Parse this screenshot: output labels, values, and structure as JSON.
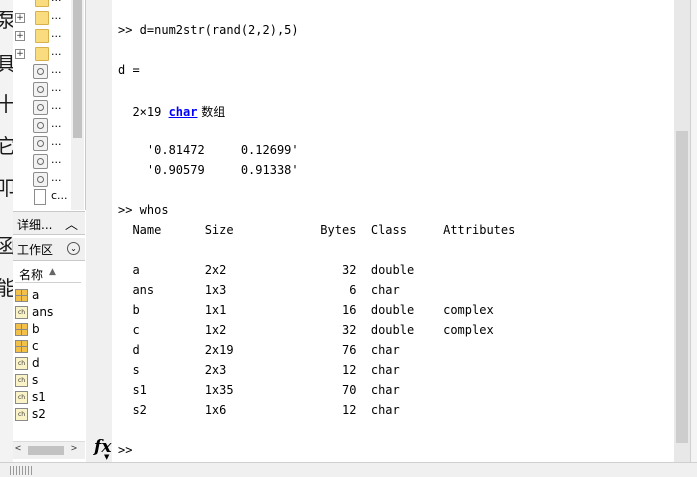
{
  "file_browser": {
    "items": [
      {
        "type": "folder",
        "expander": "",
        "label": "..."
      },
      {
        "type": "folder",
        "expander": "+",
        "label": "..."
      },
      {
        "type": "folder",
        "expander": "+",
        "label": "..."
      },
      {
        "type": "folder",
        "expander": "+",
        "label": "..."
      },
      {
        "type": "file",
        "label": "..."
      },
      {
        "type": "file",
        "label": "..."
      },
      {
        "type": "file",
        "label": "..."
      },
      {
        "type": "file",
        "label": "..."
      },
      {
        "type": "file",
        "label": "..."
      },
      {
        "type": "file",
        "label": "..."
      },
      {
        "type": "file",
        "label": "..."
      },
      {
        "type": "doc",
        "label": "c..."
      }
    ]
  },
  "details_bar": {
    "label": "详细...",
    "chevron": "︿"
  },
  "workspace": {
    "title": "工作区",
    "menu_icon": "⌄",
    "column_name": "名称",
    "sort_indicator": "▲",
    "variables": [
      {
        "name": "a",
        "icon": "matrix"
      },
      {
        "name": "ans",
        "icon": "char"
      },
      {
        "name": "b",
        "icon": "matrix"
      },
      {
        "name": "c",
        "icon": "matrix"
      },
      {
        "name": "d",
        "icon": "char"
      },
      {
        "name": "s",
        "icon": "char"
      },
      {
        "name": "s1",
        "icon": "char"
      },
      {
        "name": "s2",
        "icon": "char"
      }
    ],
    "char_icon_text": "ch"
  },
  "command_window": {
    "line1": ">> d=num2str(rand(2,2),5)",
    "line2": "d =",
    "line3_prefix": "  2×19 ",
    "line3_keyword": "char",
    "line3_suffix": " 数组",
    "line4": "    '0.81472     0.12699'",
    "line5": "    '0.90579     0.91338'",
    "line6": ">> whos",
    "whos_header": "  Name      Size            Bytes  Class     Attributes",
    "whos_rows": [
      "  a         2x2                32  double",
      "  ans       1x3                 6  char",
      "  b         1x1                16  double    complex",
      "  c         1x2                32  double    complex",
      "  d         2x19               76  char",
      "  s         2x3                12  char",
      "  s1        1x35               70  char",
      "  s2        1x6                12  char"
    ],
    "prompt": ">>",
    "fx_label": "fx",
    "fx_chevron": "▼"
  },
  "scrollbar": {
    "left_arrow": "<",
    "right_arrow": ">"
  },
  "background_glyphs": [
    "泵",
    "具",
    "十",
    "它",
    "叩",
    "函",
    "能"
  ]
}
